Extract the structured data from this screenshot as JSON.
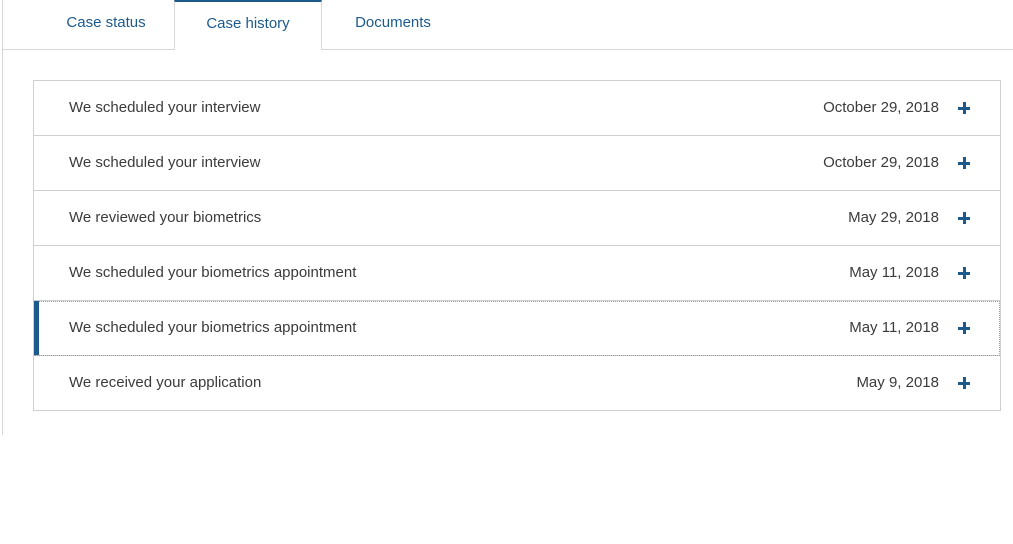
{
  "tabs": [
    {
      "label": "Case status",
      "active": false
    },
    {
      "label": "Case history",
      "active": true
    },
    {
      "label": "Documents",
      "active": false
    }
  ],
  "history": [
    {
      "title": "We scheduled your interview",
      "date": "October 29, 2018",
      "icon": "plus-icon"
    },
    {
      "title": "We scheduled your interview",
      "date": "October 29, 2018",
      "icon": "plus-icon"
    },
    {
      "title": "We reviewed your biometrics",
      "date": "May 29, 2018",
      "icon": "plus-icon"
    },
    {
      "title": "We scheduled your biometrics appointment",
      "date": "May 11, 2018",
      "icon": "plus-icon"
    },
    {
      "title": "We scheduled your biometrics appointment",
      "date": "May 11, 2018",
      "icon": "plus-icon",
      "focused": true
    },
    {
      "title": "We received your application",
      "date": "May 9, 2018",
      "icon": "plus-icon"
    }
  ],
  "colors": {
    "accent": "#1d5a8c",
    "text": "#3b3b3b",
    "border": "#cfcfcf"
  }
}
